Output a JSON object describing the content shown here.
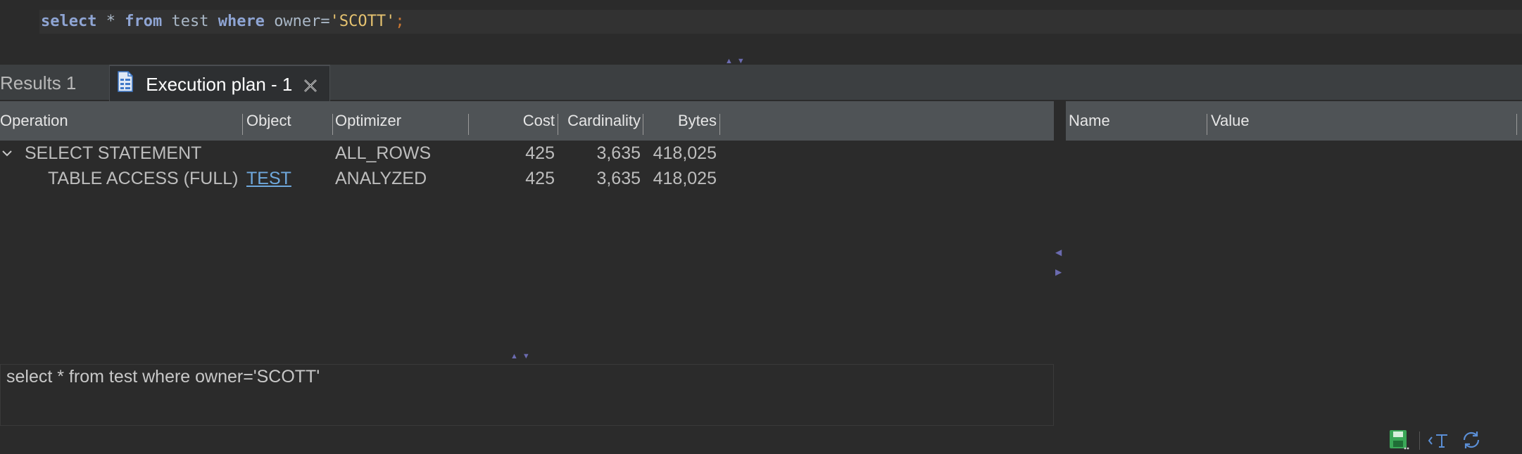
{
  "editor": {
    "sql": {
      "kw_select": "select",
      "star": "*",
      "kw_from": "from",
      "table": "test",
      "kw_where": "where",
      "column": "owner=",
      "string": "'SCOTT'",
      "semicolon": ";"
    }
  },
  "tabs": [
    {
      "label": "Results 1",
      "active": false
    },
    {
      "label": "Execution plan - 1",
      "active": true
    }
  ],
  "plan": {
    "columns": [
      "Operation",
      "Object",
      "Optimizer",
      "Cost",
      "Cardinality",
      "Bytes"
    ],
    "rows": [
      {
        "operation": "SELECT STATEMENT",
        "object": "",
        "optimizer": "ALL_ROWS",
        "cost": "425",
        "cardinality": "3,635",
        "bytes": "418,025",
        "expanded": true
      },
      {
        "operation": "TABLE ACCESS (FULL)",
        "object": "TEST",
        "optimizer": "ANALYZED",
        "cost": "425",
        "cardinality": "3,635",
        "bytes": "418,025"
      }
    ]
  },
  "properties": {
    "columns": [
      "Name",
      "Value"
    ]
  },
  "query_preview": "select * from test where owner='SCOTT'",
  "icons": {
    "tab": "execution-plan-doc-icon",
    "close": "close-icon",
    "status": [
      "save-icon",
      "text-format-icon",
      "refresh-link-icon"
    ]
  },
  "colors": {
    "background": "#2b2b2b",
    "header": "#4f5356",
    "keyword": "#8fa5d4",
    "string": "#e6c370",
    "link": "#6fa8dc"
  }
}
